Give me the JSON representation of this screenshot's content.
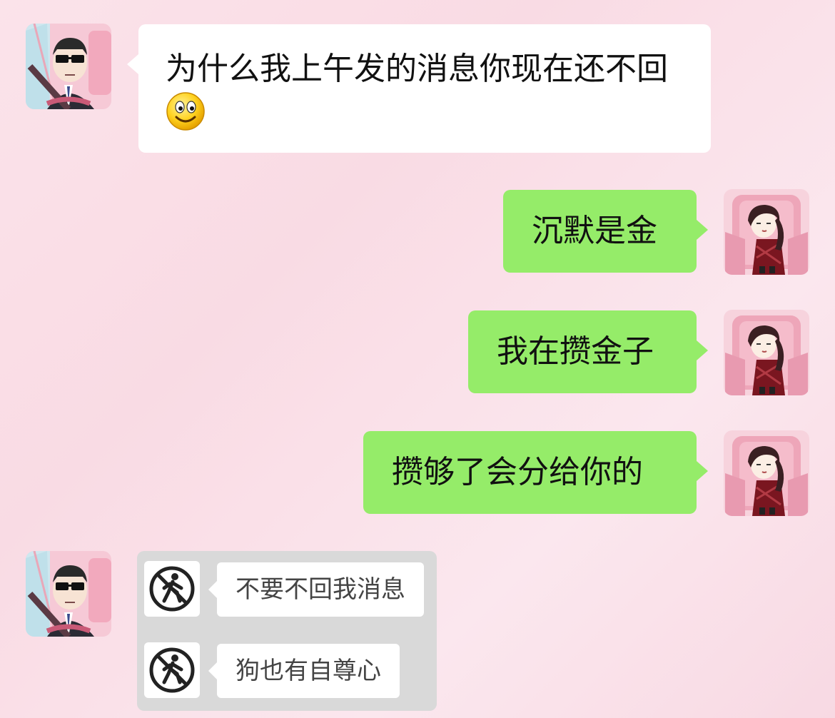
{
  "colors": {
    "incoming_bubble": "#ffffff",
    "outgoing_bubble": "#95ec69",
    "background": "#fbe3ea",
    "sticker_background": "#d9d9d9"
  },
  "messages": [
    {
      "side": "left",
      "avatar": "man-in-sunglasses-driving-avatar",
      "text": "为什么我上午发的消息你现在还不回",
      "emoji": "smile-emoji"
    },
    {
      "side": "right",
      "avatar": "girl-in-red-sitting-avatar",
      "text": "沉默是金"
    },
    {
      "side": "right",
      "avatar": "girl-in-red-sitting-avatar",
      "text": "我在攒金子"
    },
    {
      "side": "right",
      "avatar": "girl-in-red-sitting-avatar",
      "text": "攒够了会分给你的"
    },
    {
      "side": "left",
      "avatar": "man-in-sunglasses-driving-avatar",
      "type": "sticker",
      "sticker": {
        "rows": [
          {
            "icon": "no-pedestrian-sign-icon",
            "text": "不要不回我消息"
          },
          {
            "icon": "no-pedestrian-sign-icon",
            "text": "狗也有自尊心"
          }
        ]
      }
    }
  ]
}
